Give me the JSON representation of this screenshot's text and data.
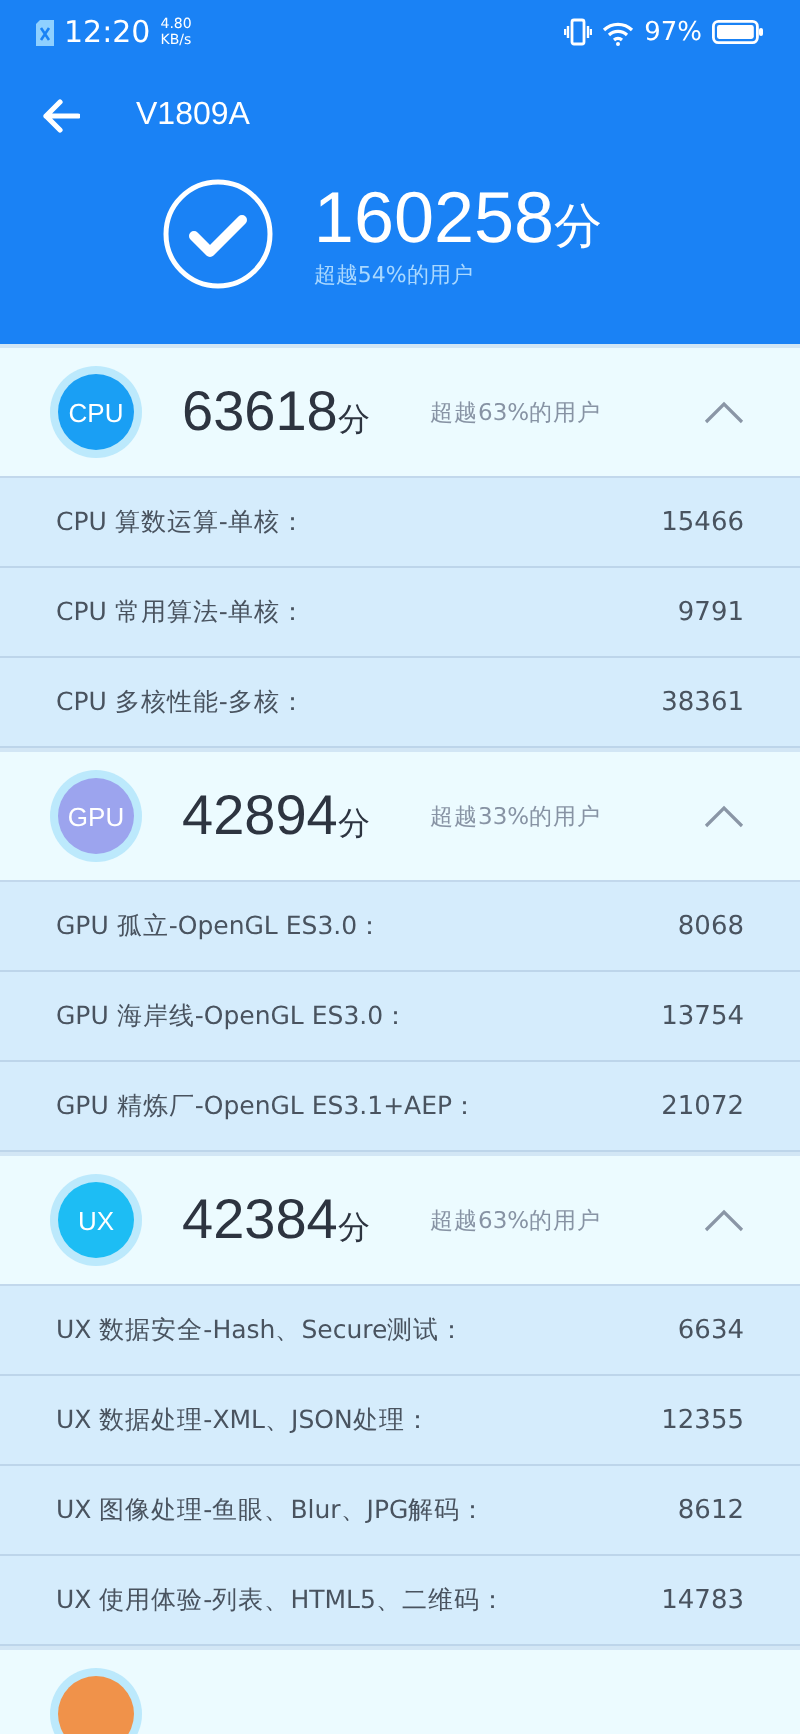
{
  "status_bar": {
    "time": "12:20",
    "speed_value": "4.80",
    "speed_unit": "KB/s",
    "battery": "97%"
  },
  "header": {
    "title": "V1809A",
    "total_score": "160258",
    "score_unit": "分",
    "percentile": "超越54%的用户"
  },
  "sections": [
    {
      "icon_label": "CPU",
      "color": "#1a9ff4",
      "score": "63618",
      "unit": "分",
      "percentile": "超越63%的用户",
      "expanded": true,
      "rows": [
        {
          "label": "CPU 算数运算-单核：",
          "value": "15466"
        },
        {
          "label": "CPU 常用算法-单核：",
          "value": "9791"
        },
        {
          "label": "CPU 多核性能-多核：",
          "value": "38361"
        }
      ]
    },
    {
      "icon_label": "GPU",
      "color": "#9ca4ee",
      "score": "42894",
      "unit": "分",
      "percentile": "超越33%的用户",
      "expanded": true,
      "rows": [
        {
          "label": "GPU 孤立-OpenGL ES3.0：",
          "value": "8068"
        },
        {
          "label": "GPU 海岸线-OpenGL ES3.0：",
          "value": "13754"
        },
        {
          "label": "GPU 精炼厂-OpenGL ES3.1+AEP：",
          "value": "21072"
        }
      ]
    },
    {
      "icon_label": "UX",
      "color": "#1dbdf4",
      "score": "42384",
      "unit": "分",
      "percentile": "超越63%的用户",
      "expanded": true,
      "rows": [
        {
          "label": "UX 数据安全-Hash、Secure测试：",
          "value": "6634"
        },
        {
          "label": "UX 数据处理-XML、JSON处理：",
          "value": "12355"
        },
        {
          "label": "UX 图像处理-鱼眼、Blur、JPG解码：",
          "value": "8612"
        },
        {
          "label": "UX 使用体验-列表、HTML5、二维码：",
          "value": "14783"
        }
      ]
    },
    {
      "color": "#f0924a"
    }
  ]
}
